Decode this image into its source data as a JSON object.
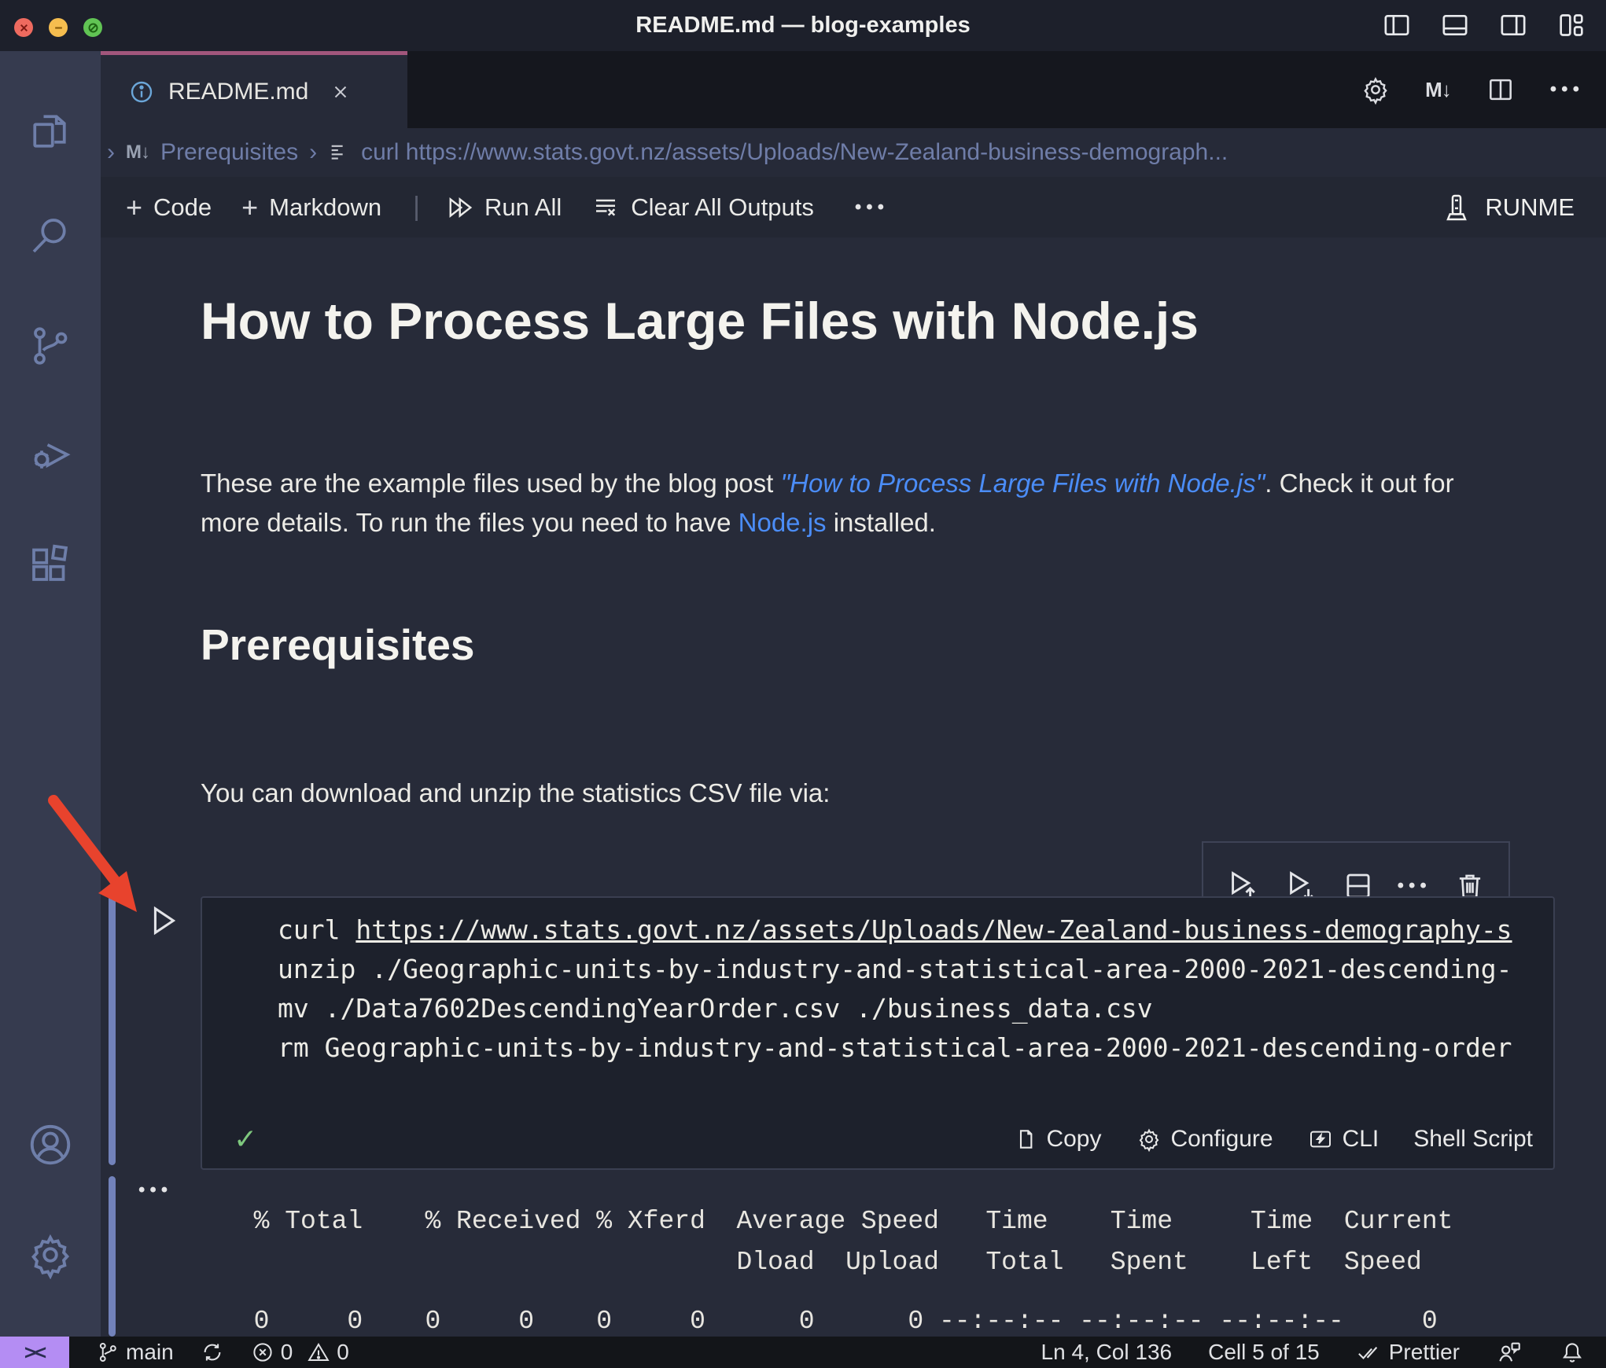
{
  "window": {
    "title": "README.md — blog-examples"
  },
  "tab": {
    "label": "README.md"
  },
  "icons": {
    "markdown_badge": "M↓",
    "ellipsis": "•••",
    "plus": "+",
    "check": "✓",
    "remote": "><"
  },
  "breadcrumb": {
    "sep": "›",
    "section": "Prerequisites",
    "command": "curl https://www.stats.govt.nz/assets/Uploads/New-Zealand-business-demograph..."
  },
  "toolbar": {
    "add_code": "Code",
    "add_markdown": "Markdown",
    "run_all": "Run All",
    "clear_outputs": "Clear All Outputs",
    "runme": "RUNME"
  },
  "doc": {
    "title": "How to Process Large Files with Node.js",
    "para_before_link": "These are the example files used by the blog post ",
    "para_link_blog": "\"How to Process Large Files with Node.js\"",
    "para_mid": ". Check it out for more details. To run the files you need to have ",
    "para_link_node": "Node.js",
    "para_after": " installed.",
    "section_title": "Prerequisites",
    "para2": "You can download and unzip the statistics CSV file via:"
  },
  "cell": {
    "code_prefix": "curl ",
    "code_url": "https://www.stats.govt.nz/assets/Uploads/New-Zealand-business-demography-s",
    "code_line2": "unzip ./Geographic-units-by-industry-and-statistical-area-2000-2021-descending-",
    "code_line3": "mv ./Data7602DescendingYearOrder.csv ./business_data.csv",
    "code_line4": "rm Geographic-units-by-industry-and-statistical-area-2000-2021-descending-order",
    "copy": "Copy",
    "configure": "Configure",
    "cli": "CLI",
    "language": "Shell Script"
  },
  "output": {
    "header_lines": "  % Total    % Received % Xferd  Average Speed   Time    Time     Time  Current\n                                 Dload  Upload   Total   Spent    Left  Speed",
    "progress_line": "  0     0    0     0    0     0      0      0 --:--:-- --:--:-- --:--:--     0"
  },
  "statusbar": {
    "branch": "main",
    "errors": "0",
    "warnings": "0",
    "cursor": "Ln 4, Col 136",
    "cell_position": "Cell 5 of 15",
    "formatter": "Prettier"
  },
  "colors": {
    "tab_accent": "#a1567c",
    "link": "#4b8df8",
    "remote_chip": "#b48df3",
    "arrow": "#e8432d",
    "success": "#7ec87e"
  }
}
